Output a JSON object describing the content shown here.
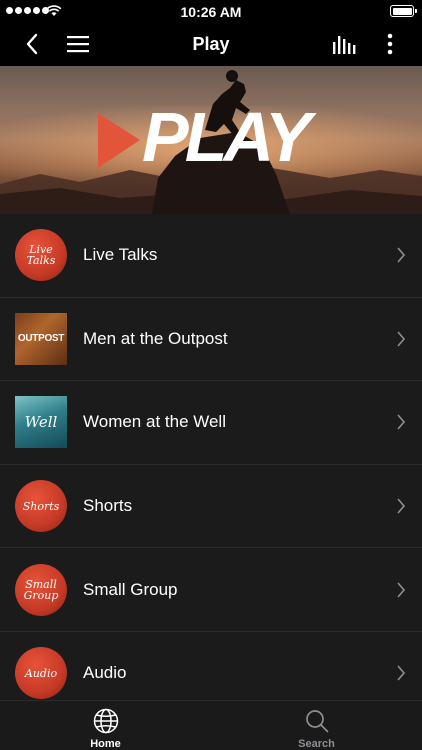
{
  "status_bar": {
    "time": "10:26 AM"
  },
  "nav": {
    "title": "Play"
  },
  "hero": {
    "logo_text": "PLAY"
  },
  "rows": [
    {
      "label": "Live Talks",
      "thumb_text": "Live\nTalks"
    },
    {
      "label": "Men at the Outpost",
      "thumb_text": "OUTPOST"
    },
    {
      "label": "Women at the Well",
      "thumb_text": "Well"
    },
    {
      "label": "Shorts",
      "thumb_text": "Shorts"
    },
    {
      "label": "Small Group",
      "thumb_text": "Small\nGroup"
    },
    {
      "label": "Audio",
      "thumb_text": "Audio"
    }
  ],
  "tabs": [
    {
      "label": "Home",
      "icon": "globe-icon",
      "color": "#ffffff"
    },
    {
      "label": "Search",
      "icon": "search-icon",
      "color": "#8e8e93"
    }
  ],
  "colors": {
    "accent": "#e2553a",
    "list_bg": "#1b1b1c",
    "separator": "#2d2d2f"
  }
}
